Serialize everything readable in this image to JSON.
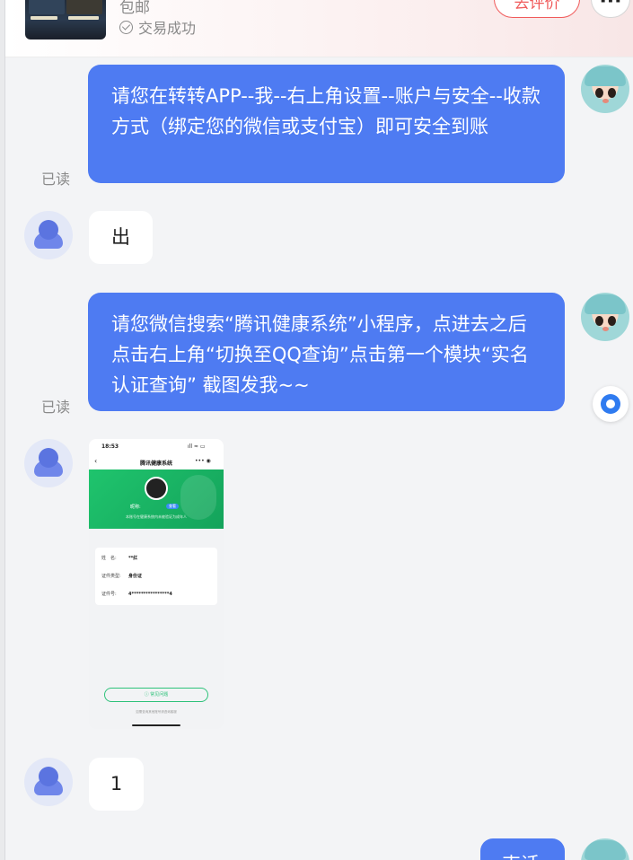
{
  "order": {
    "shipping": "包邮",
    "status": "交易成功",
    "review_button": "去评价",
    "more_button": "···"
  },
  "messages": [
    {
      "from": "self",
      "text": "请您在转转APP--我--右上角设置--账户与安全--收款方式（绑定您的微信或支付宝）即可安全到账",
      "read": "已读"
    },
    {
      "from": "user",
      "text": "出"
    },
    {
      "from": "self",
      "text": "请您微信搜索“腾讯健康系统”小程序，点进去之后点击右上角“切换至QQ查询”点击第一个模块“实名认证查询” 截图发我~~",
      "read": "已读"
    },
    {
      "from": "user",
      "type": "image"
    },
    {
      "from": "user",
      "text": "1"
    },
    {
      "from": "self",
      "text": "束话"
    }
  ],
  "screenshot": {
    "time": "18:53",
    "title": "腾讯健康系统",
    "nickname": "昵称:",
    "tag": "查看",
    "subtitle": "本账号在健康系统内未被验证为成年人",
    "fields": [
      {
        "key": "姓　名:",
        "value": "**红"
      },
      {
        "key": "证件类型:",
        "value": "身份证"
      },
      {
        "key": "证件号:",
        "value": "4****************4"
      }
    ],
    "faq": "ⓘ 常见问题",
    "footer": "如需查询其他账号请咨询客服"
  },
  "colors": {
    "bubble_self": "#4e7bf2",
    "bubble_user": "#ffffff",
    "review_accent": "#f05b5b",
    "background": "#f3f4f6"
  }
}
